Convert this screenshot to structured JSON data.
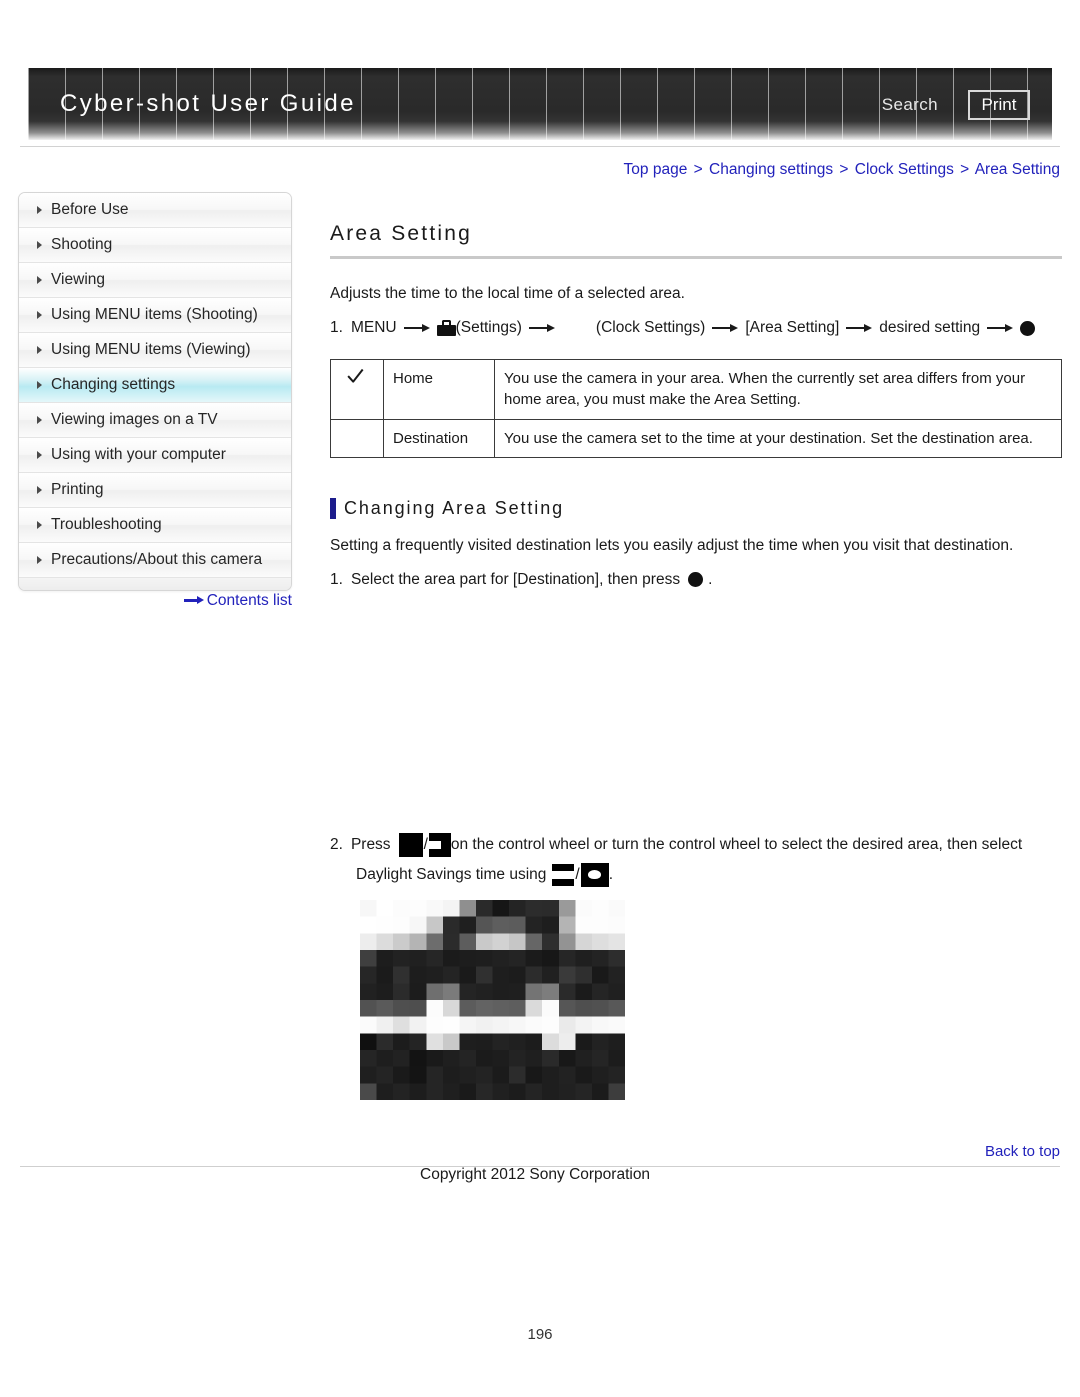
{
  "header": {
    "title": "Cyber-shot User Guide",
    "search_label": "Search",
    "print_label": "Print"
  },
  "breadcrumb": {
    "separator": ">",
    "items": [
      "Top page",
      "Changing settings",
      "Clock Settings",
      "Area Setting"
    ]
  },
  "sidebar": {
    "items": [
      {
        "label": "Before Use",
        "active": false
      },
      {
        "label": "Shooting",
        "active": false
      },
      {
        "label": "Viewing",
        "active": false
      },
      {
        "label": "Using MENU items (Shooting)",
        "active": false
      },
      {
        "label": "Using MENU items (Viewing)",
        "active": false
      },
      {
        "label": "Changing settings",
        "active": true
      },
      {
        "label": "Viewing images on a TV",
        "active": false
      },
      {
        "label": "Using with your computer",
        "active": false
      },
      {
        "label": "Printing",
        "active": false
      },
      {
        "label": "Troubleshooting",
        "active": false
      },
      {
        "label": "Precautions/About this camera",
        "active": false
      }
    ],
    "contents_link": "Contents list"
  },
  "main": {
    "title": "Area Setting",
    "intro": "Adjusts the time to the local time of a selected area.",
    "menu_path": {
      "number": "1.",
      "menu_label": "MENU",
      "settings_label": "(Settings)",
      "clock_settings_label": "(Clock Settings)",
      "area_setting_label": "[Area Setting]",
      "desired_setting_label": "desired setting"
    },
    "table": {
      "rows": [
        {
          "checked": true,
          "name": "Home",
          "description": "You use the camera in your area. When the currently set area differs from your home area, you must make the Area Setting."
        },
        {
          "checked": false,
          "name": "Destination",
          "description": "You use the camera set to the time at your destination. Set the destination area."
        }
      ]
    },
    "subsection": {
      "title": "Changing Area Setting",
      "body": "Setting a frequently visited destination lets you easily adjust the time when you visit that destination.",
      "step1": {
        "number": "1.",
        "text_before": "Select the area part for [Destination], then press",
        "text_after": "."
      },
      "step2": {
        "number": "2.",
        "text_before": "Press",
        "text_middle": "on the control wheel or turn the control wheel to select the desired area, then select",
        "text_line2": "Daylight Savings time using",
        "text_after": "."
      }
    }
  },
  "footer": {
    "back_to_top": "Back to top",
    "copyright": "Copyright 2012 Sony Corporation",
    "page_number": "196"
  },
  "colors": {
    "link": "#2222bb",
    "accent_bar": "#1c1c8c",
    "active_nav": "#b8eaf2",
    "header_dark": "#2a2a2a"
  },
  "screen_image": {
    "description": "pixelated camera screen capture",
    "grid_cols": 16,
    "grid_rows": 12,
    "pixels": [
      [
        "#f7f7f7",
        "#ffffff",
        "#fcfcfc",
        "#fdfdfd",
        "#f9f9f9",
        "#f4f4f4",
        "#8f8f8f",
        "#2a2a2a",
        "#161616",
        "#242424",
        "#2c2c2c",
        "#2b2b2b",
        "#9a9a9a",
        "#fbfbfb",
        "#fdfdfd",
        "#fafafa"
      ],
      [
        "#ffffff",
        "#fefefe",
        "#fdfdfd",
        "#f7f7f7",
        "#c7c7c7",
        "#2a2a2a",
        "#1f1f1f",
        "#555555",
        "#5e5e5e",
        "#5c5c5c",
        "#232323",
        "#1e1e1e",
        "#b4b4b4",
        "#fdfdfd",
        "#fdfdfd",
        "#fcfcfc"
      ],
      [
        "#ededed",
        "#dcdcdc",
        "#cbcbcb",
        "#b4b4b4",
        "#6d6d6d",
        "#2b2b2b",
        "#5d5d5d",
        "#c9c9c9",
        "#d2d2d2",
        "#c6c6c6",
        "#666666",
        "#2e2e2e",
        "#939393",
        "#d6d6d6",
        "#dedede",
        "#e4e4e4"
      ],
      [
        "#3f3f3f",
        "#1d1d1d",
        "#222222",
        "#202020",
        "#262626",
        "#1b1b1b",
        "#1d1d1d",
        "#1e1e1e",
        "#212121",
        "#242424",
        "#1b1b1b",
        "#171717",
        "#262626",
        "#1f1f1f",
        "#232323",
        "#2d2d2d"
      ],
      [
        "#262626",
        "#1b1b1b",
        "#303030",
        "#1d1d1d",
        "#1f1f1f",
        "#242424",
        "#1a1a1a",
        "#303030",
        "#1e1e1e",
        "#1c1c1c",
        "#2c2c2c",
        "#202020",
        "#3a3a3a",
        "#2f2f2f",
        "#191919",
        "#222222"
      ],
      [
        "#212121",
        "#1d1d1d",
        "#2b2b2b",
        "#1c1c1c",
        "#6f6f6f",
        "#7b7b7b",
        "#242424",
        "#212121",
        "#1e1e1e",
        "#1f1f1f",
        "#747474",
        "#7d7d7d",
        "#2a2a2a",
        "#1b1b1b",
        "#252525",
        "#202020"
      ],
      [
        "#525252",
        "#5a5a5a",
        "#4f4f4f",
        "#4e4e4e",
        "#fcfcfc",
        "#d8d8d8",
        "#5c5c5c",
        "#636363",
        "#606060",
        "#5e5e5e",
        "#dadada",
        "#fbfbfb",
        "#565656",
        "#4f4f4f",
        "#515151",
        "#585858"
      ],
      [
        "#fbfbfb",
        "#f0f0f0",
        "#dfdfdf",
        "#f2f2f2",
        "#fdfdfd",
        "#fefefe",
        "#f5f5f5",
        "#f1f1f1",
        "#f4f4f4",
        "#f7f7f7",
        "#fbfbfb",
        "#fdfdfd",
        "#eaeaea",
        "#f3f3f3",
        "#f8f8f8",
        "#fafafa"
      ],
      [
        "#101010",
        "#2b2b2b",
        "#1c1c1c",
        "#242424",
        "#e0e0e0",
        "#c9c9c9",
        "#1e1e1e",
        "#1d1d1d",
        "#232323",
        "#202020",
        "#1c1c1c",
        "#dcdcdc",
        "#ededed",
        "#1a1a1a",
        "#222222",
        "#1e1e1e"
      ],
      [
        "#252525",
        "#1e1e1e",
        "#222222",
        "#131313",
        "#1a1a1a",
        "#1f1f1f",
        "#242424",
        "#1b1b1b",
        "#1d1d1d",
        "#232323",
        "#1f1f1f",
        "#2a2a2a",
        "#181818",
        "#202020",
        "#252525",
        "#1c1c1c"
      ],
      [
        "#1f1f1f",
        "#242424",
        "#1a1a1a",
        "#141414",
        "#252525",
        "#1d1d1d",
        "#202020",
        "#232323",
        "#1b1b1b",
        "#2c2c2c",
        "#181818",
        "#1e1e1e",
        "#222222",
        "#1a1a1a",
        "#1f1f1f",
        "#232323"
      ],
      [
        "#4a4a4a",
        "#1e1e1e",
        "#232323",
        "#1d1d1d",
        "#252525",
        "#1f1f1f",
        "#1a1a1a",
        "#272727",
        "#202020",
        "#1c1c1c",
        "#242424",
        "#1e1e1e",
        "#212121",
        "#252525",
        "#1b1b1b",
        "#3d3d3d"
      ]
    ]
  }
}
